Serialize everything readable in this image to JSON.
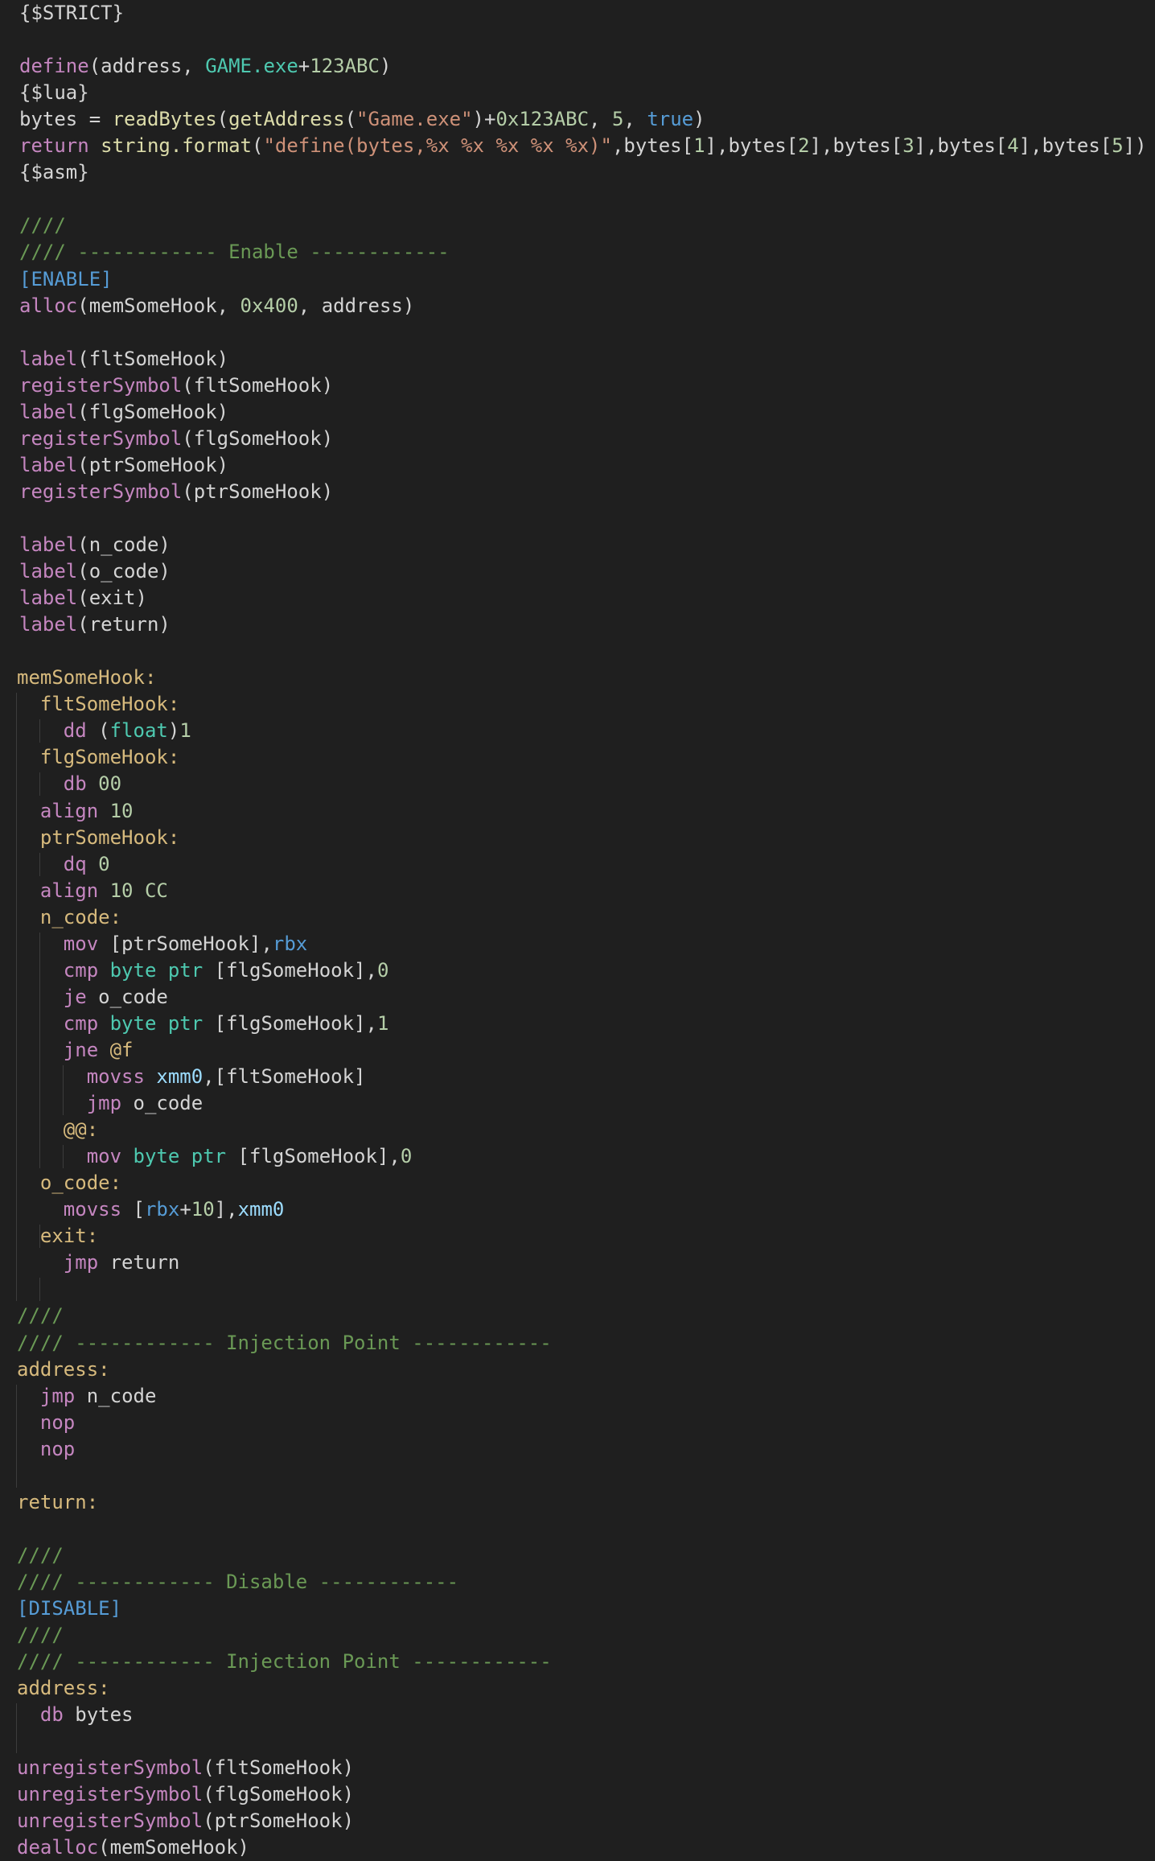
{
  "editor": {
    "language": "Cheat Engine Auto Assembler",
    "theme_colors": {
      "background": "#1f1f1f",
      "default": "#d4d4d4",
      "keyword": "#c586c0",
      "type": "#4ec9b0",
      "number": "#b5cea8",
      "string": "#ce9178",
      "comment": "#6a9955",
      "section": "#569cd6",
      "function": "#dcdcaa",
      "label": "#d7ba7d",
      "register": "#9cdcfe",
      "indent_guide": "#3c3c3c"
    },
    "lines": [
      [
        [
          "d",
          "{$STRICT}"
        ]
      ],
      [],
      [
        [
          "k",
          "define"
        ],
        [
          "d",
          "(address, "
        ],
        [
          "t",
          "GAME.exe"
        ],
        [
          "d",
          "+"
        ],
        [
          "n",
          "123ABC"
        ],
        [
          "d",
          ")"
        ]
      ],
      [
        [
          "d",
          "{$lua}"
        ]
      ],
      [
        [
          "d",
          "bytes = "
        ],
        [
          "f",
          "readBytes"
        ],
        [
          "d",
          "("
        ],
        [
          "f",
          "getAddress"
        ],
        [
          "d",
          "("
        ],
        [
          "s",
          "\"Game.exe\""
        ],
        [
          "d",
          ")+"
        ],
        [
          "n",
          "0x123ABC"
        ],
        [
          "d",
          ", "
        ],
        [
          "n",
          "5"
        ],
        [
          "d",
          ", "
        ],
        [
          "b",
          "true"
        ],
        [
          "d",
          ")"
        ]
      ],
      [
        [
          "k",
          "return"
        ],
        [
          "d",
          " "
        ],
        [
          "f",
          "string.format"
        ],
        [
          "d",
          "("
        ],
        [
          "s",
          "\"define(bytes,%x %x %x %x %x)\""
        ],
        [
          "d",
          ",bytes["
        ],
        [
          "n",
          "1"
        ],
        [
          "d",
          "],bytes["
        ],
        [
          "n",
          "2"
        ],
        [
          "d",
          "],bytes["
        ],
        [
          "n",
          "3"
        ],
        [
          "d",
          "],bytes["
        ],
        [
          "n",
          "4"
        ],
        [
          "d",
          "],bytes["
        ],
        [
          "n",
          "5"
        ],
        [
          "d",
          "])"
        ]
      ],
      [
        [
          "d",
          "{$asm}"
        ]
      ],
      [],
      [
        [
          "c",
          "////"
        ]
      ],
      [
        [
          "c",
          "//// ------------ Enable ------------"
        ]
      ],
      [
        [
          "b",
          "[ENABLE]"
        ]
      ],
      [
        [
          "k",
          "alloc"
        ],
        [
          "d",
          "(memSomeHook, "
        ],
        [
          "n",
          "0x400"
        ],
        [
          "d",
          ", address)"
        ]
      ],
      [],
      [
        [
          "k",
          "label"
        ],
        [
          "d",
          "(fltSomeHook)"
        ]
      ],
      [
        [
          "k",
          "registerSymbol"
        ],
        [
          "d",
          "(fltSomeHook)"
        ]
      ],
      [
        [
          "k",
          "label"
        ],
        [
          "d",
          "(flgSomeHook)"
        ]
      ],
      [
        [
          "k",
          "registerSymbol"
        ],
        [
          "d",
          "(flgSomeHook)"
        ]
      ],
      [
        [
          "k",
          "label"
        ],
        [
          "d",
          "(ptrSomeHook)"
        ]
      ],
      [
        [
          "k",
          "registerSymbol"
        ],
        [
          "d",
          "(ptrSomeHook)"
        ]
      ],
      [],
      [
        [
          "k",
          "label"
        ],
        [
          "d",
          "(n_code)"
        ]
      ],
      [
        [
          "k",
          "label"
        ],
        [
          "d",
          "(o_code)"
        ]
      ],
      [
        [
          "k",
          "label"
        ],
        [
          "d",
          "(exit)"
        ]
      ],
      [
        [
          "k",
          "label"
        ],
        [
          "d",
          "(return)"
        ]
      ],
      [],
      [
        [
          "l",
          "memSomeHook:"
        ]
      ],
      [
        [
          "d",
          "  "
        ],
        [
          "l",
          "fltSomeHook:"
        ]
      ],
      [
        [
          "d",
          "    "
        ],
        [
          "k",
          "dd"
        ],
        [
          "d",
          " ("
        ],
        [
          "t",
          "float"
        ],
        [
          "d",
          ")"
        ],
        [
          "n",
          "1"
        ]
      ],
      [
        [
          "d",
          "  "
        ],
        [
          "l",
          "flgSomeHook:"
        ]
      ],
      [
        [
          "d",
          "    "
        ],
        [
          "k",
          "db"
        ],
        [
          "d",
          " "
        ],
        [
          "n",
          "00"
        ]
      ],
      [
        [
          "d",
          "  "
        ],
        [
          "k",
          "align"
        ],
        [
          "d",
          " "
        ],
        [
          "n",
          "10"
        ]
      ],
      [
        [
          "d",
          "  "
        ],
        [
          "l",
          "ptrSomeHook:"
        ]
      ],
      [
        [
          "d",
          "    "
        ],
        [
          "k",
          "dq"
        ],
        [
          "d",
          " "
        ],
        [
          "n",
          "0"
        ]
      ],
      [
        [
          "d",
          "  "
        ],
        [
          "k",
          "align"
        ],
        [
          "d",
          " "
        ],
        [
          "n",
          "10 CC"
        ]
      ],
      [
        [
          "d",
          "  "
        ],
        [
          "l",
          "n_code:"
        ]
      ],
      [
        [
          "d",
          "    "
        ],
        [
          "k",
          "mov"
        ],
        [
          "d",
          " [ptrSomeHook],"
        ],
        [
          "b",
          "rbx"
        ]
      ],
      [
        [
          "d",
          "    "
        ],
        [
          "k",
          "cmp"
        ],
        [
          "d",
          " "
        ],
        [
          "t",
          "byte ptr"
        ],
        [
          "d",
          " [flgSomeHook],"
        ],
        [
          "n",
          "0"
        ]
      ],
      [
        [
          "d",
          "    "
        ],
        [
          "k",
          "je"
        ],
        [
          "d",
          " o_code"
        ]
      ],
      [
        [
          "d",
          "    "
        ],
        [
          "k",
          "cmp"
        ],
        [
          "d",
          " "
        ],
        [
          "t",
          "byte ptr"
        ],
        [
          "d",
          " [flgSomeHook],"
        ],
        [
          "n",
          "1"
        ]
      ],
      [
        [
          "d",
          "    "
        ],
        [
          "k",
          "jne"
        ],
        [
          "d",
          " "
        ],
        [
          "l",
          "@f"
        ]
      ],
      [
        [
          "d",
          "      "
        ],
        [
          "k",
          "movss"
        ],
        [
          "d",
          " "
        ],
        [
          "r",
          "xmm0"
        ],
        [
          "d",
          ",[fltSomeHook]"
        ]
      ],
      [
        [
          "d",
          "      "
        ],
        [
          "k",
          "jmp"
        ],
        [
          "d",
          " o_code"
        ]
      ],
      [
        [
          "d",
          "    "
        ],
        [
          "l",
          "@@:"
        ]
      ],
      [
        [
          "d",
          "      "
        ],
        [
          "k",
          "mov"
        ],
        [
          "d",
          " "
        ],
        [
          "t",
          "byte ptr"
        ],
        [
          "d",
          " [flgSomeHook],"
        ],
        [
          "n",
          "0"
        ]
      ],
      [
        [
          "d",
          "  "
        ],
        [
          "l",
          "o_code:"
        ]
      ],
      [
        [
          "d",
          "    "
        ],
        [
          "k",
          "movss"
        ],
        [
          "d",
          " ["
        ],
        [
          "b",
          "rbx"
        ],
        [
          "d",
          "+"
        ],
        [
          "n",
          "10"
        ],
        [
          "d",
          "],"
        ],
        [
          "r",
          "xmm0"
        ]
      ],
      [
        [
          "d",
          "  "
        ],
        [
          "l",
          "exit:"
        ]
      ],
      [
        [
          "d",
          "    "
        ],
        [
          "k",
          "jmp"
        ],
        [
          "d",
          " return"
        ]
      ],
      [],
      [
        [
          "c",
          "////"
        ]
      ],
      [
        [
          "c",
          "//// ------------ Injection Point ------------"
        ]
      ],
      [
        [
          "l",
          "address:"
        ]
      ],
      [
        [
          "d",
          "  "
        ],
        [
          "k",
          "jmp"
        ],
        [
          "d",
          " n_code"
        ]
      ],
      [
        [
          "d",
          "  "
        ],
        [
          "k",
          "nop"
        ]
      ],
      [
        [
          "d",
          "  "
        ],
        [
          "k",
          "nop"
        ]
      ],
      [],
      [
        [
          "l",
          "return:"
        ]
      ],
      [],
      [
        [
          "c",
          "////"
        ]
      ],
      [
        [
          "c",
          "//// ------------ Disable ------------"
        ]
      ],
      [
        [
          "b",
          "[DISABLE]"
        ]
      ],
      [
        [
          "c",
          "////"
        ]
      ],
      [
        [
          "c",
          "//// ------------ Injection Point ------------"
        ]
      ],
      [
        [
          "l",
          "address:"
        ]
      ],
      [
        [
          "d",
          "  "
        ],
        [
          "k",
          "db"
        ],
        [
          "d",
          " bytes"
        ]
      ],
      [],
      [
        [
          "k",
          "unregisterSymbol"
        ],
        [
          "d",
          "(fltSomeHook)"
        ]
      ],
      [
        [
          "k",
          "unregisterSymbol"
        ],
        [
          "d",
          "(flgSomeHook)"
        ]
      ],
      [
        [
          "k",
          "unregisterSymbol"
        ],
        [
          "d",
          "(ptrSomeHook)"
        ]
      ],
      [
        [
          "k",
          "dealloc"
        ],
        [
          "d",
          "(memSomeHook)"
        ]
      ]
    ]
  }
}
